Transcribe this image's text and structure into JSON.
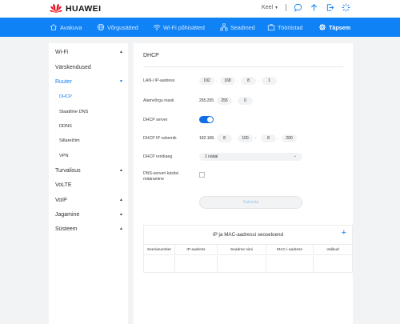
{
  "header": {
    "brand": "HUAWEI",
    "language_label": "Keel",
    "icons": [
      "message-icon",
      "update-icon",
      "logout-icon",
      "loading-icon"
    ]
  },
  "nav": {
    "items": [
      {
        "label": "Avakuva",
        "icon": "home-icon",
        "active": false
      },
      {
        "label": "Võrgusätted",
        "icon": "globe-icon",
        "active": false
      },
      {
        "label": "Wi-Fi põhisätted",
        "icon": "wifi-icon",
        "active": false
      },
      {
        "label": "Seadmed",
        "icon": "devices-icon",
        "active": false
      },
      {
        "label": "Tööriistad",
        "icon": "toolbox-icon",
        "active": false
      },
      {
        "label": "Täpsem",
        "icon": "gear-icon",
        "active": true
      }
    ]
  },
  "sidebar": {
    "items": [
      {
        "label": "Wi-Fi",
        "caret": "▲"
      },
      {
        "label": "Värskendused",
        "caret": ""
      },
      {
        "label": "Ruuter",
        "caret": "▼",
        "active": true
      },
      {
        "label": "DHCP",
        "sub": true,
        "active": true
      },
      {
        "label": "Staatiline DNS",
        "sub": true
      },
      {
        "label": "DDNS",
        "sub": true
      },
      {
        "label": "Sillarežiim",
        "sub": true
      },
      {
        "label": "VPN",
        "sub": true
      },
      {
        "label": "Turvalisus",
        "caret": "▲"
      },
      {
        "label": "VoLTE",
        "caret": ""
      },
      {
        "label": "VoIP",
        "caret": "▲"
      },
      {
        "label": "Jagamine",
        "caret": "▲"
      },
      {
        "label": "Süsteem",
        "caret": "▲"
      }
    ]
  },
  "main": {
    "title": "DHCP",
    "lan_ip": {
      "label": "LAN-i IP-aadress",
      "octets": [
        "192",
        "168",
        "8",
        "1"
      ]
    },
    "subnet": {
      "label": "Alamvõrgu mask",
      "prefix": "255.255.",
      "octets": [
        "255",
        "0"
      ]
    },
    "dhcp_server": {
      "label": "DHCP server",
      "enabled": true
    },
    "ip_range": {
      "label": "DHCP IP vahemik",
      "prefix": "192.168.",
      "start": [
        "8",
        "100"
      ],
      "end": [
        "8",
        "200"
      ]
    },
    "lease": {
      "label": "DHCP rendiaeg",
      "value": "1 nädal"
    },
    "dns_override": {
      "label": "DNS-serveri käsitsi määramine",
      "checked": false
    },
    "save_label": "Salvesta",
    "binding_table": {
      "title": "IP ja MAC-aadressi seoseloend",
      "add_icon": "plus-icon",
      "columns": [
        "Seerianumber",
        "IP-aadress",
        "Seadme nimi",
        "MAC-i aadress",
        "Valikud"
      ]
    }
  },
  "colors": {
    "accent": "#0f82f5",
    "nav_bg": "#0f82f5",
    "toggle_on": "#0f6ee8"
  }
}
